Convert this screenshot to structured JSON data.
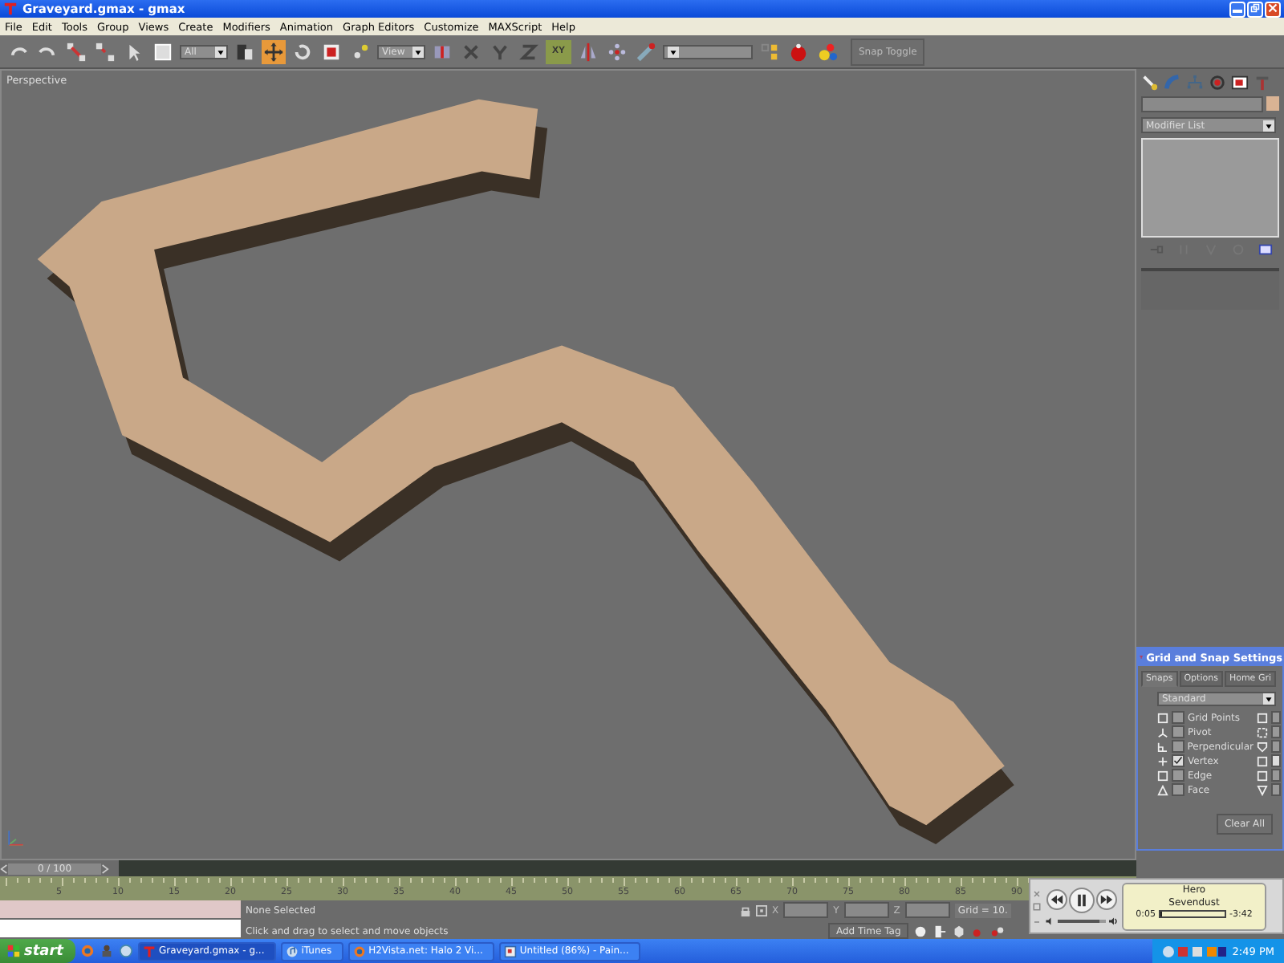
{
  "window": {
    "title": "Graveyard.gmax - gmax"
  },
  "menu": [
    "File",
    "Edit",
    "Tools",
    "Group",
    "Views",
    "Create",
    "Modifiers",
    "Animation",
    "Graph Editors",
    "Customize",
    "MAXScript",
    "Help"
  ],
  "toolbar": {
    "selection_filter": "All",
    "move_tool_selected": true,
    "reference_coord": "View",
    "axis_constraint": {
      "label": "XY",
      "selected": true
    },
    "snap_toggle": "Snap Toggle"
  },
  "viewport": {
    "label": "Perspective"
  },
  "command_panel": {
    "modifier_list": "Modifier List"
  },
  "grid_snap_dialog": {
    "title": "Grid and Snap Settings",
    "tabs": [
      {
        "label": "Snaps",
        "selected": true
      },
      {
        "label": "Options",
        "selected": false
      },
      {
        "label": "Home Gri",
        "selected": false
      }
    ],
    "preset": "Standard",
    "snaps": [
      {
        "label": "Grid Points",
        "checked": false
      },
      {
        "label": "Pivot",
        "checked": false
      },
      {
        "label": "Perpendicular",
        "checked": false
      },
      {
        "label": "Vertex",
        "checked": true
      },
      {
        "label": "Edge",
        "checked": false
      },
      {
        "label": "Face",
        "checked": false
      }
    ],
    "right_column": [
      {
        "checked": false
      },
      {
        "checked": false
      },
      {
        "checked": false
      },
      {
        "checked": true
      },
      {
        "checked": false
      },
      {
        "checked": false
      }
    ],
    "clear_button": "Clear All"
  },
  "time_slider": {
    "label": "0 / 100",
    "level": 0
  },
  "ruler_labels": [
    "5",
    "10",
    "15",
    "20",
    "25",
    "30",
    "35",
    "40",
    "45",
    "50",
    "55",
    "60",
    "65",
    "70",
    "75",
    "80",
    "85",
    "90"
  ],
  "status": {
    "selection": "None Selected",
    "prompt": "Click and drag to select and move objects",
    "x_label": "X",
    "y_label": "Y",
    "z_label": "Z",
    "grid": "Grid = 10.",
    "time_tag": "Add Time Tag"
  },
  "player": {
    "track": "Hero",
    "artist": "Sevendust",
    "elapsed": "0:05",
    "remaining": "-3:42",
    "progress": {
      "level": 0.03
    },
    "volume": {
      "level": 0.85
    }
  },
  "taskbar": {
    "start": "start",
    "tasks": [
      {
        "label": "Graveyard.gmax - g...",
        "selected": true
      },
      {
        "label": "iTunes",
        "selected": false
      },
      {
        "label": "H2Vista.net: Halo 2 Vi...",
        "selected": false
      },
      {
        "label": "Untitled (86%) - Pain...",
        "selected": false
      }
    ],
    "clock": "2:49 PM"
  }
}
